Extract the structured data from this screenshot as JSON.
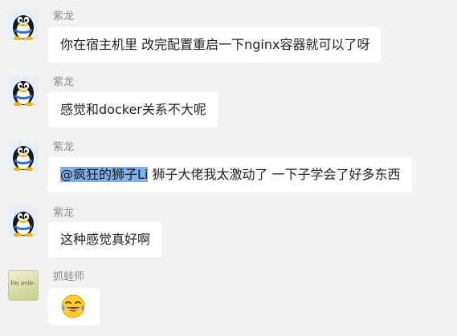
{
  "messages": [
    {
      "sender": "紫龙",
      "avatar": "qq-penguin-icon",
      "text": "你在宿主机里 改完配置重启一下nginx容器就可以了呀"
    },
    {
      "sender": "紫龙",
      "avatar": "qq-penguin-icon",
      "text": "感觉和docker关系不大呢"
    },
    {
      "sender": "紫龙",
      "avatar": "qq-penguin-icon",
      "mention": "@疯狂的狮子Li",
      "text": " 狮子大佬我太激动了 一下子学会了好多东西"
    },
    {
      "sender": "紫龙",
      "avatar": "qq-penguin-icon",
      "text": "这种感觉真好啊"
    },
    {
      "sender": "抓蛙师",
      "avatar": "you-smile-avatar",
      "avatar_text": "You smile.",
      "emoji": "tears-of-joy-emoji"
    }
  ]
}
